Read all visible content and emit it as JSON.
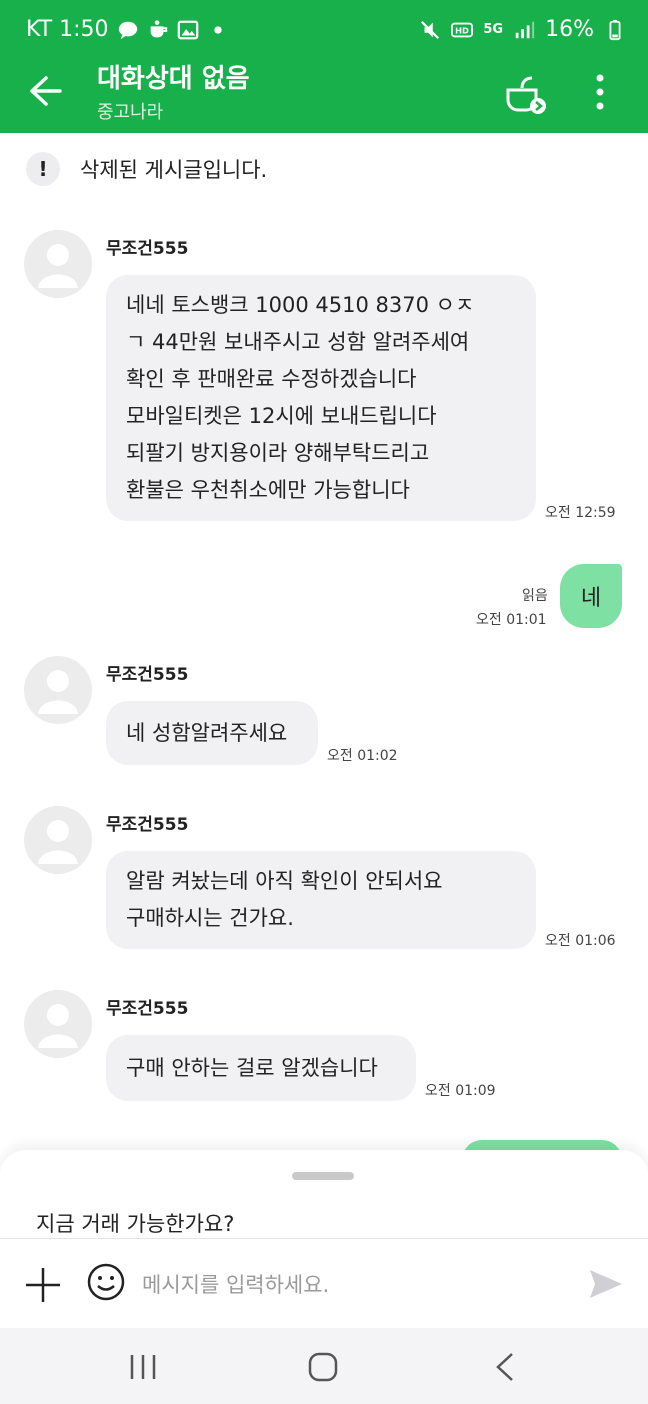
{
  "status_bar": {
    "carrier_time": "KT 1:50",
    "network": "5G",
    "battery": "16%"
  },
  "header": {
    "title": "대화상대 없음",
    "subtitle": "중고나라"
  },
  "notice": {
    "text": "삭제된 게시글입니다."
  },
  "messages": [
    {
      "sender": "무조건555",
      "text": "네네 토스뱅크 1000 4510 8370 ㅇㅈ\nㄱ 44만원 보내주시고 성함 알려주세여\n확인 후 판매완료 수정하겠습니다\n모바일티켓은 12시에 보내드립니다\n되팔기 방지용이라 양해부탁드리고\n환불은 우천취소에만 가능합니다",
      "time": "오전 12:59"
    },
    {
      "outgoing": true,
      "text": "네",
      "read_label": "읽음",
      "time": "오전 01:01"
    },
    {
      "sender": "무조건555",
      "text": "네 성함알려주세요",
      "time": "오전 01:02"
    },
    {
      "sender": "무조건555",
      "text": "알람 켜놨는데 아직 확인이 안되서요\n구매하시는 건가요.",
      "time": "오전 01:06"
    },
    {
      "sender": "무조건555",
      "text": "구매 안하는 걸로 알겠습니다",
      "time": "오전 01:09"
    }
  ],
  "composer": {
    "quick_reply": "지금 거래 가능한가요?",
    "placeholder": "메시지를 입력하세요."
  },
  "colors": {
    "brand_green": "#17b04b",
    "outgoing_bubble": "#7fe0a3",
    "incoming_bubble": "#f1f1f4"
  }
}
